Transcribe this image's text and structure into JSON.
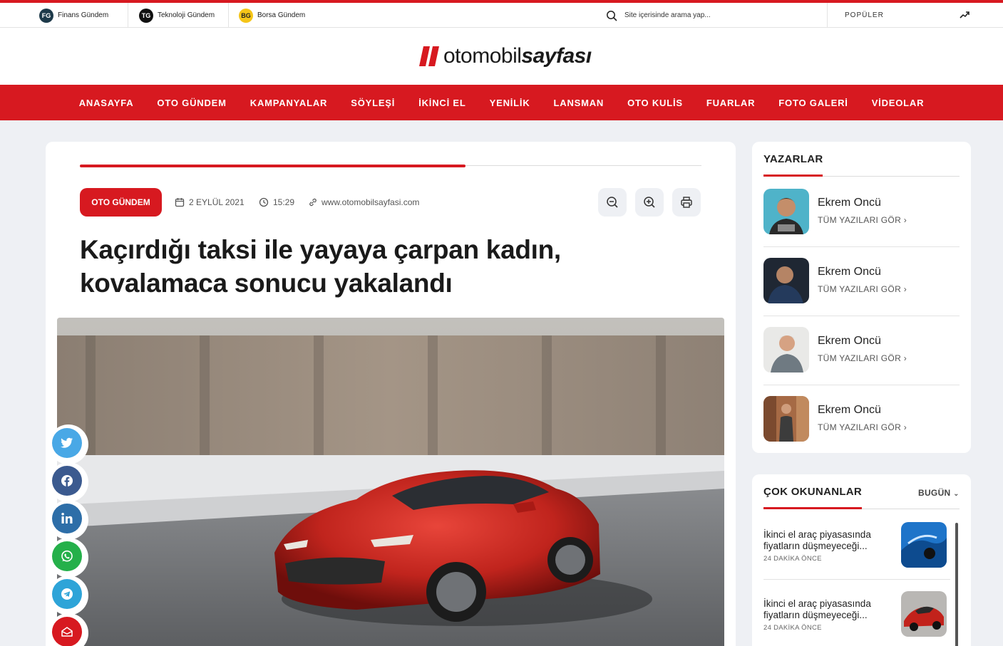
{
  "topbar": {
    "sites": [
      {
        "badge": "FG",
        "label": "Finans Gündem",
        "color": "#1e3a4a",
        "text_color": "#ffffff"
      },
      {
        "badge": "TG",
        "label": "Teknoloji Gündem",
        "color": "#111111",
        "text_color": "#ffffff"
      },
      {
        "badge": "BG",
        "label": "Borsa Gündem",
        "color": "#f5c518",
        "text_color": "#222222"
      }
    ],
    "search_placeholder": "Site içerisinde arama yap...",
    "popular_label": "POPÜLER"
  },
  "logo": {
    "part1": "otomobil",
    "part2": "sayfası"
  },
  "nav": [
    "ANASAYFA",
    "OTO GÜNDEM",
    "KAMPANYALAR",
    "SÖYLEŞİ",
    "İKİNCİ EL",
    "YENİLİK",
    "LANSMAN",
    "OTO KULİS",
    "FUARLAR",
    "FOTO GALERİ",
    "VİDEOLAR"
  ],
  "article": {
    "reading_progress": 0.62,
    "category": "OTO GÜNDEM",
    "date": "2 EYLÜL 2021",
    "time": "15:29",
    "source": "www.otomobilsayfasi.com",
    "title_line1": "Kaçırdığı taksi ile yayaya çarpan kadın,",
    "title_line2": "kovalamaca sonucu yakalandı"
  },
  "share": [
    "twitter-icon",
    "facebook-icon",
    "linkedin-icon",
    "whatsapp-icon",
    "telegram-icon",
    "mail-icon"
  ],
  "writers": {
    "title": "YAZARLAR",
    "items": [
      {
        "name": "Ekrem Oncü",
        "link": "TÜM YAZILARI GÖR"
      },
      {
        "name": "Ekrem Oncü",
        "link": "TÜM YAZILARI GÖR"
      },
      {
        "name": "Ekrem Oncü",
        "link": "TÜM YAZILARI GÖR"
      },
      {
        "name": "Ekrem Oncü",
        "link": "TÜM YAZILARI GÖR"
      }
    ]
  },
  "most_read": {
    "title": "ÇOK OKUNANLAR",
    "filter": "BUGÜN",
    "items": [
      {
        "title": "İkinci el araç piyasasında fiyatların düşmeyeceği...",
        "time": "24 DAKİKA ÖNCE"
      },
      {
        "title": "İkinci el araç piyasasında fiyatların düşmeyeceği...",
        "time": "24 DAKİKA ÖNCE"
      }
    ]
  },
  "colors": {
    "brand": "#d71920",
    "background": "#eef0f4"
  }
}
